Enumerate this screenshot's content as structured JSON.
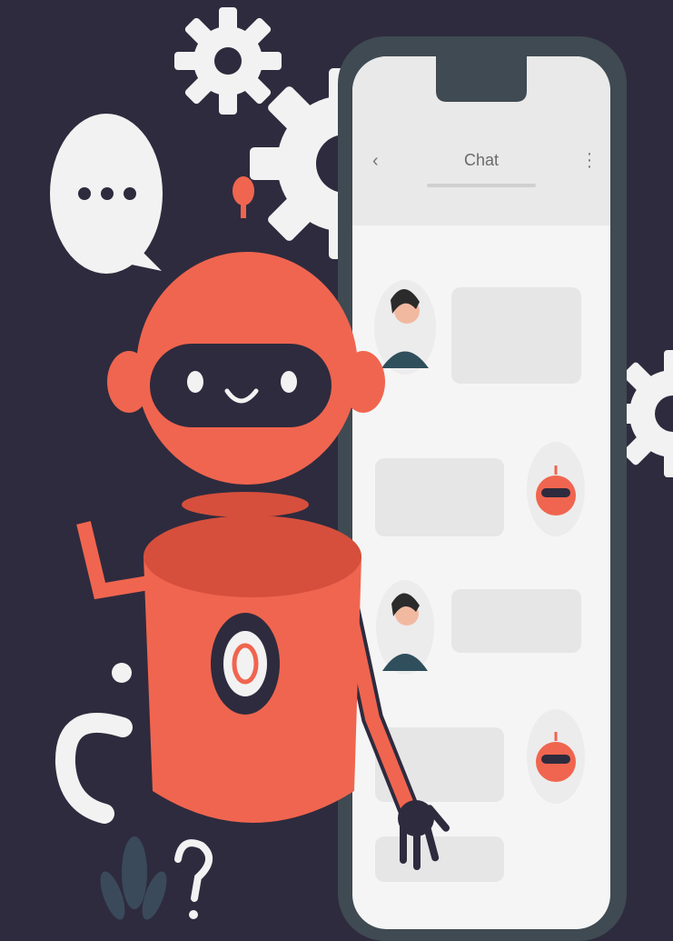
{
  "phone": {
    "title": "Chat",
    "back_icon": "chevron-left-icon",
    "menu_icon": "kebab-menu-icon"
  },
  "colors": {
    "background": "#2e2b3e",
    "robot": "#f0654f",
    "robot_dark": "#d64f3c",
    "phone_frame": "#3f4a52",
    "screen": "#f5f5f5",
    "bubble": "#e6e6e6",
    "gear": "#f2f2f2"
  }
}
